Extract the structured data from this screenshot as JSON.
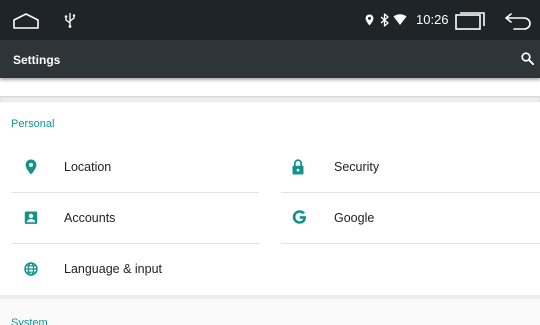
{
  "status_bar": {
    "time": "10:26",
    "icons": [
      "home-icon",
      "usb-icon",
      "location-icon",
      "bluetooth-icon",
      "wifi-icon",
      "recents-icon",
      "back-icon"
    ]
  },
  "app_bar": {
    "title": "Settings",
    "search_icon": "search-icon"
  },
  "personal": {
    "header": "Personal",
    "items": [
      {
        "label": "Location",
        "icon": "location-pin-icon"
      },
      {
        "label": "Security",
        "icon": "lock-icon"
      },
      {
        "label": "Accounts",
        "icon": "account-box-icon"
      },
      {
        "label": "Google",
        "icon": "google-g-icon"
      },
      {
        "label": "Language & input",
        "icon": "globe-icon"
      }
    ]
  },
  "system": {
    "header": "System"
  },
  "colors": {
    "status_bar": "#1e2428",
    "app_bar": "#2f3438",
    "accent": "#13938c",
    "background": "#fafafa"
  }
}
